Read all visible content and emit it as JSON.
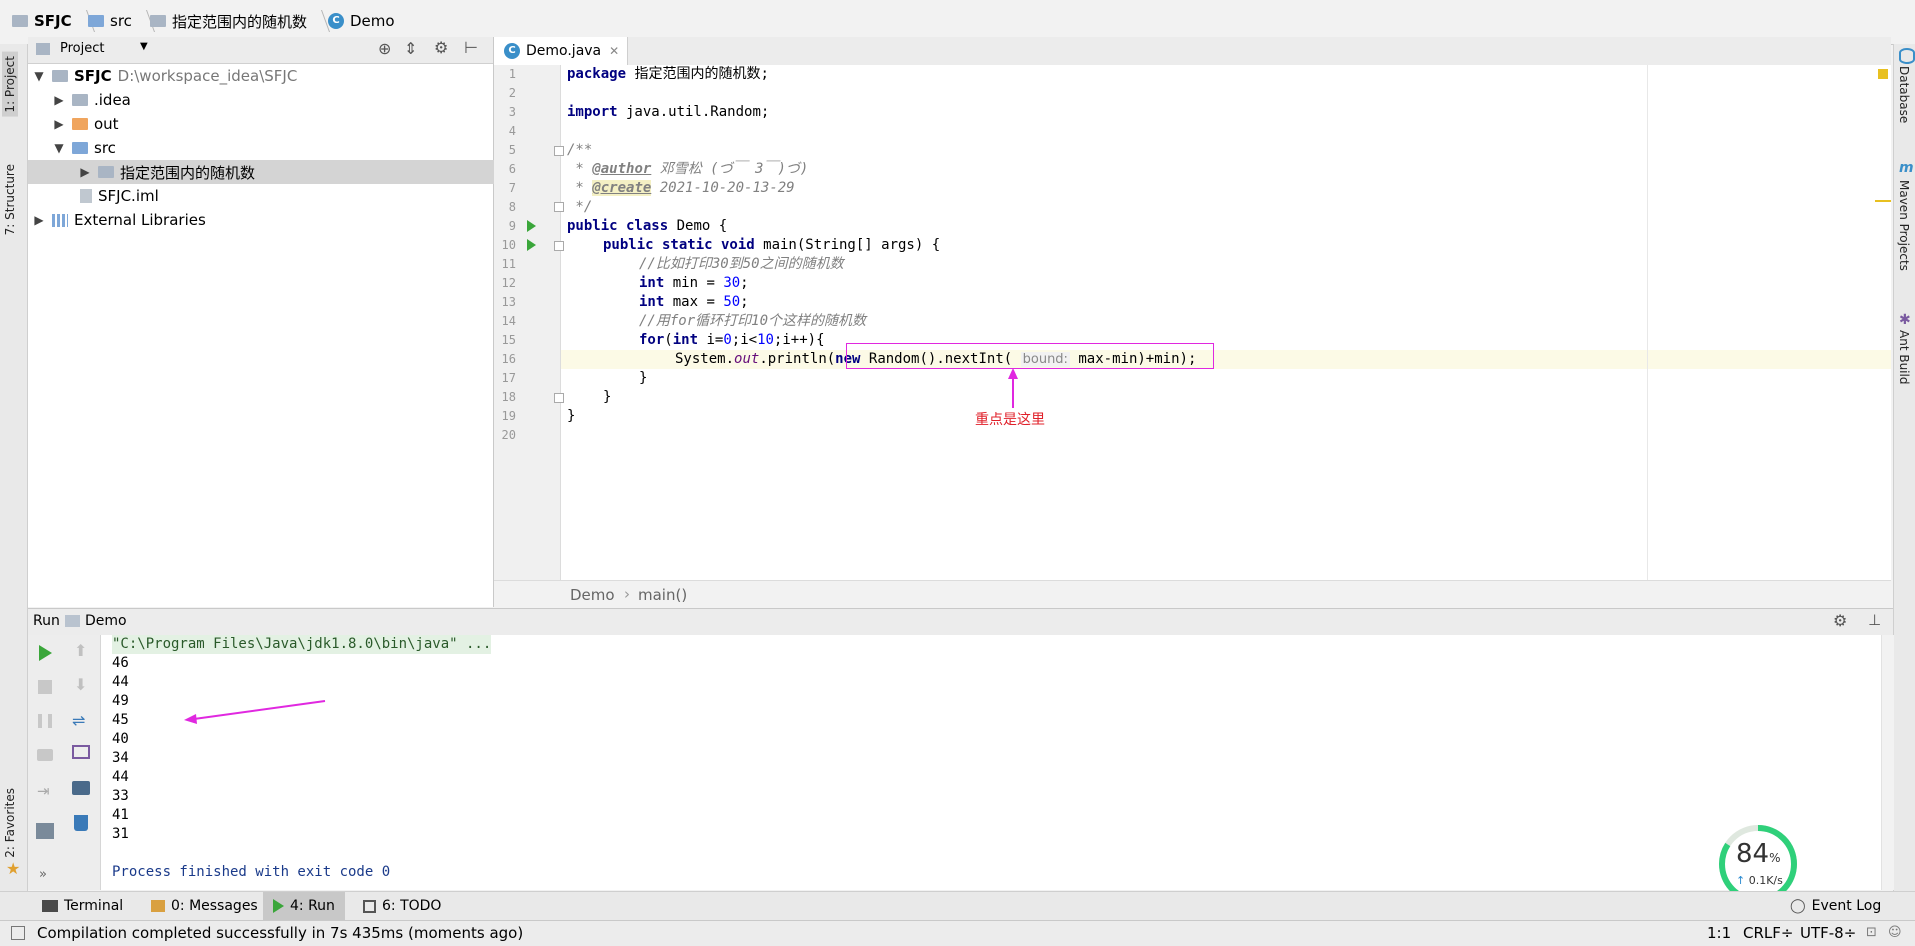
{
  "breadcrumbs": [
    "SFJC",
    "src",
    "指定范围内的随机数",
    "Demo"
  ],
  "left_strip": {
    "project_tab": "1: Project",
    "structure_tab": "7: Structure",
    "favorites_tab": "2: Favorites"
  },
  "right_strip": {
    "database_tab": "Database",
    "maven_tab": "Maven Projects",
    "ant_tab": "Ant Build"
  },
  "project_panel": {
    "title": "Project",
    "tree": [
      {
        "label": "SFJC",
        "path": "D:\\workspace_idea\\SFJC"
      },
      {
        "label": ".idea"
      },
      {
        "label": "out"
      },
      {
        "label": "src"
      },
      {
        "label": "指定范围内的随机数"
      },
      {
        "label": "SFJC.iml"
      },
      {
        "label": "External Libraries"
      }
    ]
  },
  "editor": {
    "tab_label": "Demo.java",
    "line_numbers": [
      "1",
      "2",
      "3",
      "4",
      "5",
      "6",
      "7",
      "8",
      "9",
      "10",
      "11",
      "12",
      "13",
      "14",
      "15",
      "16",
      "17",
      "18",
      "19",
      "20"
    ],
    "code": {
      "l1_kw": "package",
      "l1_rest": " 指定范围内的随机数;",
      "l3_kw": "import",
      "l3_rest": " java.util.Random;",
      "l5": "/**",
      "l6_pre": " * ",
      "l6_tag": "@author",
      "l6_rest": " 邓雪松 (づ￣ 3￣)づ)",
      "l7_pre": " * ",
      "l7_tag": "@create",
      "l7_rest": " 2021-10-20-13-29",
      "l8": " */",
      "l9_kw": "public class",
      "l9_rest": " Demo {",
      "l10_kw": "public static void",
      "l10_rest": " main(String[] args) {",
      "l11": "//比如打印30到50之间的随机数",
      "l12_kw": "int",
      "l12_mid": " min = ",
      "l12_num": "30",
      "l12_end": ";",
      "l13_kw": "int",
      "l13_mid": " max = ",
      "l13_num": "50",
      "l13_end": ";",
      "l14": "//用for循环打印10个这样的随机数",
      "l15_kw1": "for",
      "l15_a": "(",
      "l15_kw2": "int",
      "l15_b": " i=",
      "l15_n1": "0",
      "l15_c": ";i<",
      "l15_n2": "10",
      "l15_d": ";i++){",
      "l16_a": "System.",
      "l16_fld": "out",
      "l16_b": ".println(",
      "l16_kw": "new",
      "l16_c": " Random().nextInt( ",
      "l16_hint": "bound:",
      "l16_d": " max-min)+min);",
      "l17": "}",
      "l18": "}",
      "l19": "}"
    },
    "path_class": "Demo",
    "path_method": "main()"
  },
  "annotation_note": "重点是这里",
  "run_panel": {
    "title": "Run",
    "config": "Demo",
    "command": "\"C:\\Program Files\\Java\\jdk1.8.0\\bin\\java\" ...",
    "output": [
      "46",
      "44",
      "49",
      "45",
      "40",
      "34",
      "44",
      "33",
      "41",
      "31"
    ],
    "finish": "Process finished with exit code 0"
  },
  "bottom_tabs": [
    "Terminal",
    "0: Messages",
    "4: Run",
    "6: TODO"
  ],
  "event_log": "Event Log",
  "status": {
    "message": "Compilation completed successfully in 7s 435ms (moments ago)",
    "position": "1:1",
    "line_sep": "CRLF÷",
    "encoding": "UTF-8÷"
  },
  "speed_widget": {
    "percent": "84",
    "unit": "%",
    "rate": "0.1K/s"
  },
  "colors": {
    "accent": "#3a8fc9",
    "annotation": "#e028e0",
    "run_green": "#3aa63a"
  }
}
